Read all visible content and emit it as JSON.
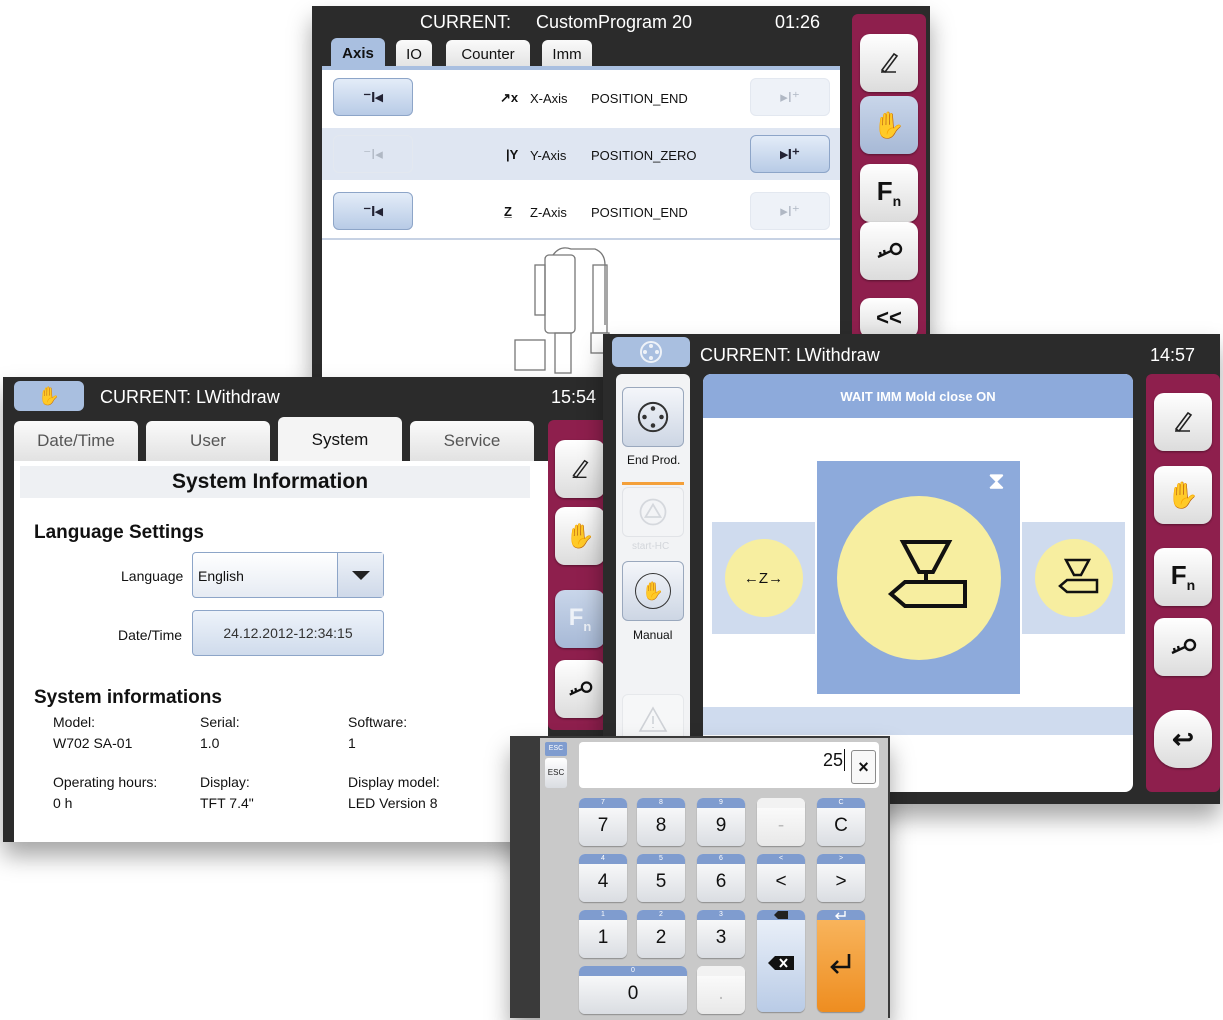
{
  "axis_panel": {
    "current_label": "CURRENT:",
    "program_name": "CustomProgram 20",
    "time": "01:26",
    "tabs": [
      {
        "label": "Axis",
        "active": true
      },
      {
        "label": "IO",
        "active": false
      },
      {
        "label": "Counter",
        "active": false
      },
      {
        "label": "Imm",
        "active": false
      }
    ],
    "axes": [
      {
        "name": "X-Axis",
        "state": "POSITION_END",
        "symbol": "x"
      },
      {
        "name": "Y-Axis",
        "state": "POSITION_ZERO",
        "symbol": "Y"
      },
      {
        "name": "Z-Axis",
        "state": "POSITION_END",
        "symbol": "Z"
      }
    ],
    "sidebar": {
      "fn_label": "F",
      "fn_sub": "n",
      "collapse_label": "<<"
    }
  },
  "system_panel": {
    "header": "CURRENT: LWithdraw",
    "time": "15:54",
    "tabs": [
      {
        "label": "Date/Time",
        "active": false
      },
      {
        "label": "User",
        "active": false
      },
      {
        "label": "System",
        "active": true
      },
      {
        "label": "Service",
        "active": false
      }
    ],
    "title": "System Information",
    "language_section": "Language Settings",
    "language_label": "Language",
    "language_value": "English",
    "datetime_label": "Date/Time",
    "datetime_value": "24.12.2012-12:34:15",
    "info_section": "System informations",
    "info": [
      {
        "label": "Model:",
        "value": "W702 SA-01"
      },
      {
        "label": "Serial:",
        "value": "1.0"
      },
      {
        "label": "Software:",
        "value": "1"
      },
      {
        "label": "Operating hours:",
        "value": "0 h"
      },
      {
        "label": "Display:",
        "value": "TFT 7.4\""
      },
      {
        "label": "Display model:",
        "value": "LED Version 8"
      }
    ],
    "sidebar": {
      "fn_label": "F",
      "fn_sub": "n"
    }
  },
  "withdraw_panel": {
    "header": "CURRENT: LWithdraw",
    "time": "14:57",
    "status": "WAIT  IMM Mold close ON",
    "left_buttons": [
      {
        "label": "End Prod."
      },
      {
        "label": "start-HC"
      },
      {
        "label": "Manual"
      }
    ],
    "z_label": "←Z→",
    "sidebar": {
      "fn_label": "F",
      "fn_sub": "n"
    }
  },
  "keypad": {
    "esc_top": "ESC",
    "esc_bottom": "ESC",
    "input_value": "25",
    "clear_label": "×",
    "keys": [
      {
        "top": "7",
        "label": "7"
      },
      {
        "top": "8",
        "label": "8"
      },
      {
        "top": "9",
        "label": "9"
      },
      {
        "top": "",
        "label": "-"
      },
      {
        "top": "C",
        "label": "C"
      },
      {
        "top": "4",
        "label": "4"
      },
      {
        "top": "5",
        "label": "5"
      },
      {
        "top": "6",
        "label": "6"
      },
      {
        "top": "<",
        "label": "<"
      },
      {
        "top": ">",
        "label": ">"
      },
      {
        "top": "1",
        "label": "1"
      },
      {
        "top": "2",
        "label": "2"
      },
      {
        "top": "3",
        "label": "3"
      },
      {
        "top": "0",
        "label": "0"
      },
      {
        "top": "",
        "label": "."
      }
    ]
  },
  "colors": {
    "bezel": "#2b2b2b",
    "sidebar": "#8e1f4d",
    "accent_blue": "#a9bfe0",
    "station_blue": "#8daadb",
    "yellow": "#f7eea0",
    "enter_orange": "#f4a03a"
  }
}
